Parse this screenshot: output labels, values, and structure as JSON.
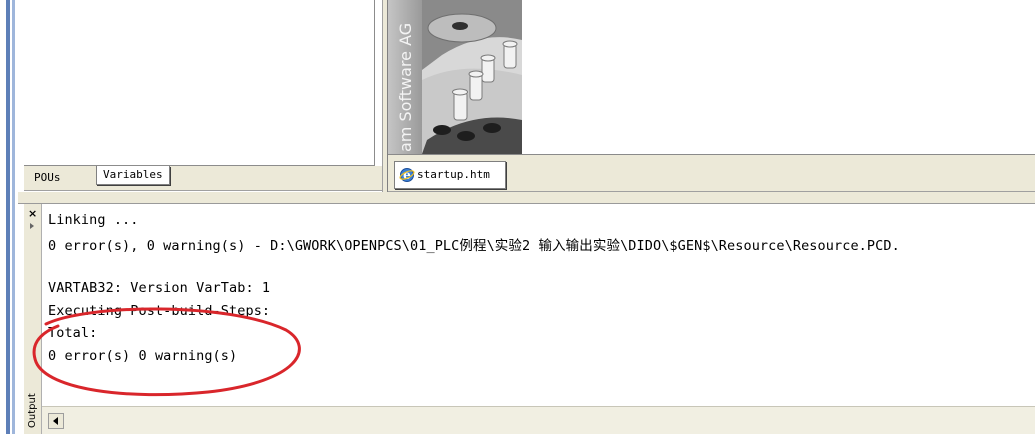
{
  "left_tabs": [
    {
      "label": "POUs"
    },
    {
      "label": "Variables"
    }
  ],
  "splash": {
    "vertical_text": "am Software AG"
  },
  "document_tab": {
    "label": "startup.htm"
  },
  "output_panel": {
    "side_label": "Output",
    "close_symbol": "×",
    "lines": [
      "Linking ...",
      "0 error(s), 0 warning(s) - D:\\GWORK\\OPENPCS\\01_PLC例程\\实验2 输入输出实验\\DIDO\\$GEN$\\Resource\\Resource.PCD.",
      "",
      "VARTAB32: Version VarTab: 1",
      "Executing Post-build-Steps:",
      "Total:",
      "0 error(s) 0 warning(s)"
    ]
  },
  "annotation": {
    "color": "#d9262b"
  },
  "colors": {
    "frame_blue": "#5d7fb8",
    "panel_bg": "#ece9d8"
  }
}
